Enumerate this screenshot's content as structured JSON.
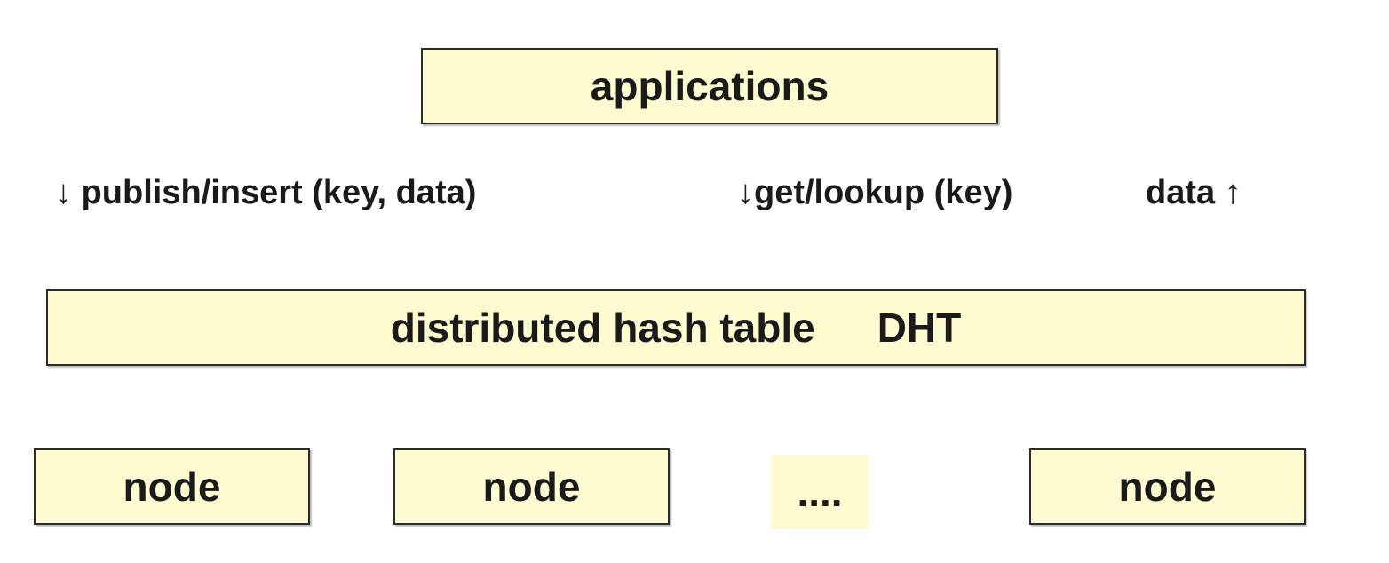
{
  "diagram": {
    "applications_label": "applications",
    "calls": {
      "publish": "↓ publish/insert (key, data)",
      "get": "↓get/lookup (key)",
      "data_return": "data ↑"
    },
    "dht": {
      "name": "distributed hash table",
      "abbrev": "DHT"
    },
    "nodes": [
      "node",
      "node",
      "node"
    ],
    "ellipsis": "...."
  }
}
